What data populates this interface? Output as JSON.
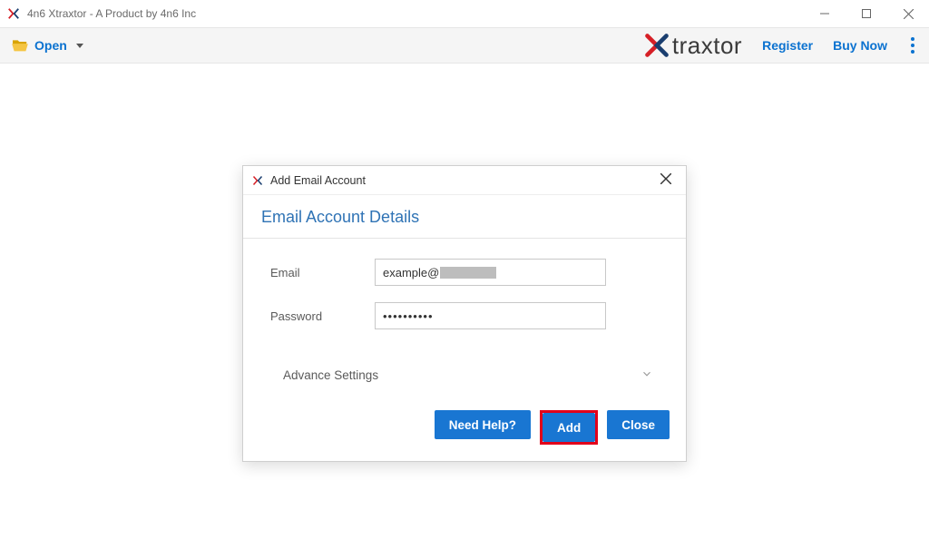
{
  "window": {
    "title": "4n6 Xtraxtor - A Product by 4n6 Inc"
  },
  "toolbar": {
    "open_label": "Open",
    "register_label": "Register",
    "buy_now_label": "Buy Now",
    "brand_text": "traxtor"
  },
  "dialog": {
    "header_title": "Add Email Account",
    "title": "Email Account Details",
    "email_label": "Email",
    "email_value_prefix": "example@",
    "password_label": "Password",
    "password_value": "••••••••••",
    "advance_label": "Advance Settings",
    "buttons": {
      "help": "Need Help?",
      "add": "Add",
      "close": "Close"
    }
  }
}
